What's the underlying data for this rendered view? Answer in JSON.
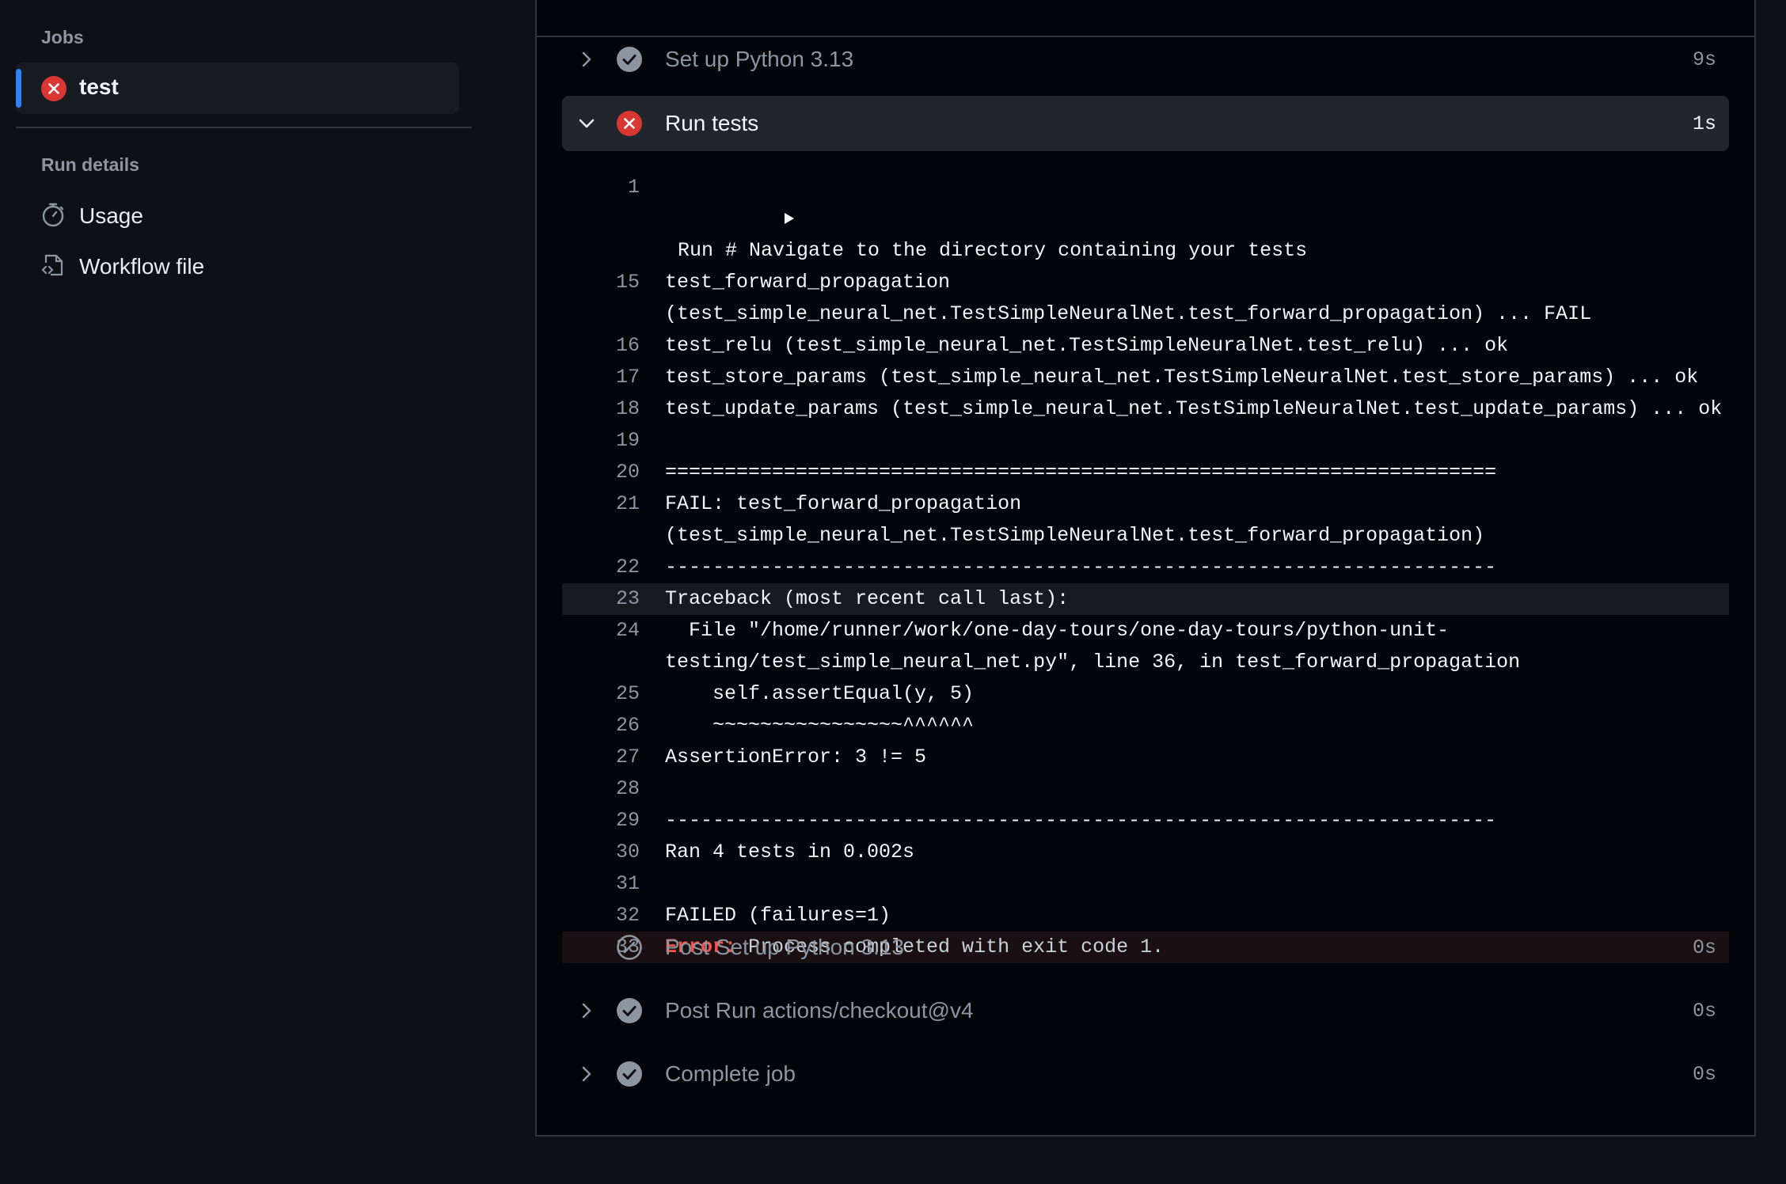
{
  "sidebar": {
    "jobs_heading": "Jobs",
    "job": {
      "name": "test",
      "status": "failed"
    },
    "run_details_heading": "Run details",
    "links": [
      {
        "label": "Usage",
        "icon": "stopwatch-icon"
      },
      {
        "label": "Workflow file",
        "icon": "file-code-icon"
      }
    ]
  },
  "steps_before": [
    {
      "name": "Set up Python 3.13",
      "duration": "9s",
      "status": "success"
    }
  ],
  "active_step": {
    "name": "Run tests",
    "duration": "1s",
    "status": "failed",
    "expanded": true
  },
  "log_lines": [
    {
      "num": "1",
      "text": "Run # Navigate to the directory containing your tests",
      "collapsible": true
    },
    {
      "num": "15",
      "text": "test_forward_propagation\n(test_simple_neural_net.TestSimpleNeuralNet.test_forward_propagation) ... FAIL"
    },
    {
      "num": "16",
      "text": "test_relu (test_simple_neural_net.TestSimpleNeuralNet.test_relu) ... ok"
    },
    {
      "num": "17",
      "text": "test_store_params (test_simple_neural_net.TestSimpleNeuralNet.test_store_params) ... ok"
    },
    {
      "num": "18",
      "text": "test_update_params (test_simple_neural_net.TestSimpleNeuralNet.test_update_params) ... ok"
    },
    {
      "num": "19",
      "text": ""
    },
    {
      "num": "20",
      "text": "======================================================================"
    },
    {
      "num": "21",
      "text": "FAIL: test_forward_propagation\n(test_simple_neural_net.TestSimpleNeuralNet.test_forward_propagation)"
    },
    {
      "num": "22",
      "text": "----------------------------------------------------------------------"
    },
    {
      "num": "23",
      "text": "Traceback (most recent call last):",
      "highlight": true
    },
    {
      "num": "24",
      "text": "  File \"/home/runner/work/one-day-tours/one-day-tours/python-unit-\ntesting/test_simple_neural_net.py\", line 36, in test_forward_propagation"
    },
    {
      "num": "25",
      "text": "    self.assertEqual(y, 5)"
    },
    {
      "num": "26",
      "text": "    ~~~~~~~~~~~~~~~~^^^^^^"
    },
    {
      "num": "27",
      "text": "AssertionError: 3 != 5"
    },
    {
      "num": "28",
      "text": ""
    },
    {
      "num": "29",
      "text": "----------------------------------------------------------------------"
    },
    {
      "num": "30",
      "text": "Ran 4 tests in 0.002s"
    },
    {
      "num": "31",
      "text": ""
    },
    {
      "num": "32",
      "text": "FAILED (failures=1)"
    }
  ],
  "error_line": {
    "num": "33",
    "prefix": "Error:",
    "message": " Process completed with exit code 1."
  },
  "steps_after": [
    {
      "name": "Post Set up Python 3.13",
      "duration": "0s",
      "status": "skipped"
    },
    {
      "name": "Post Run actions/checkout@v4",
      "duration": "0s",
      "status": "success"
    },
    {
      "name": "Complete job",
      "duration": "0s",
      "status": "success"
    }
  ],
  "colors": {
    "accent": "#2f81f7",
    "error": "#f85149",
    "success_icon": "#8d96a0",
    "background": "#0d1117"
  }
}
